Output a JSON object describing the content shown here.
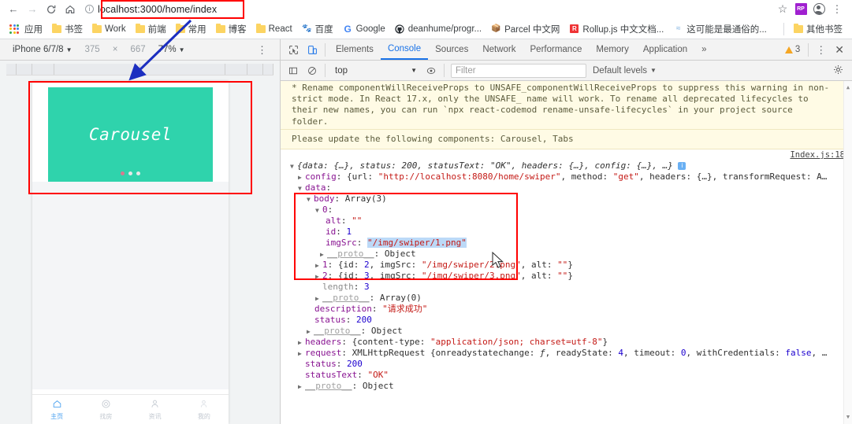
{
  "browser": {
    "nav": {
      "back": "←",
      "forward": "→",
      "reload": "C",
      "home": "⌂"
    },
    "omnibox": {
      "url": "localhost:3000/home/index",
      "info_icon": "i"
    },
    "right_icons": [
      {
        "name": "bookmark-star-icon",
        "glyph": "☆"
      },
      {
        "name": "extension-icon",
        "label": "RP"
      },
      {
        "name": "profile-avatar-icon",
        "glyph": ""
      },
      {
        "name": "chrome-menu-icon",
        "glyph": "⋮"
      }
    ],
    "bookmarks": [
      {
        "label": "应用",
        "icon": "apps-grid-icon"
      },
      {
        "label": "书签",
        "icon": "folder-icon"
      },
      {
        "label": "Work",
        "icon": "folder-icon"
      },
      {
        "label": "前端",
        "icon": "folder-icon"
      },
      {
        "label": "常用",
        "icon": "folder-icon"
      },
      {
        "label": "博客",
        "icon": "folder-icon"
      },
      {
        "label": "React",
        "icon": "folder-icon"
      },
      {
        "label": "百度",
        "icon": "baidu-icon"
      },
      {
        "label": "Google",
        "icon": "google-g-icon"
      },
      {
        "label": "deanhume/progr...",
        "icon": "github-icon"
      },
      {
        "label": "Parcel 中文网",
        "icon": "parcel-icon"
      },
      {
        "label": "Rollup.js 中文文档...",
        "icon": "rollup-icon"
      },
      {
        "label": "这可能是最通俗的...",
        "icon": "link-icon"
      }
    ],
    "other_bookmarks": {
      "label": "其他书签",
      "icon": "folder-icon"
    }
  },
  "device_toolbar": {
    "device": "iPhone 6/7/8",
    "device_caret": "▼",
    "width": "375",
    "times": "×",
    "height": "667",
    "zoom": "77%",
    "zoom_caret": "▼",
    "more": "⋮"
  },
  "mobile_page": {
    "carousel": {
      "label": "Carousel",
      "bg_color": "#2fd3ac",
      "dots": [
        {
          "active": true,
          "color": "#d9798f"
        },
        {
          "active": false,
          "color": "#e8e8e8"
        },
        {
          "active": false,
          "color": "#e8e8e8"
        }
      ]
    },
    "tabbar": [
      {
        "label": "主页",
        "icon": "home-icon",
        "glyph": "⌂",
        "active": true
      },
      {
        "label": "找房",
        "icon": "search-circle-icon",
        "glyph": "◎",
        "active": false
      },
      {
        "label": "资讯",
        "icon": "person-icon",
        "glyph": "⚇",
        "active": false
      },
      {
        "label": "我的",
        "icon": "person-icon",
        "glyph": "⚇",
        "active": false
      }
    ]
  },
  "devtools": {
    "inspect_icon": "inspect-element-icon",
    "device_toggle_icon": "toggle-device-toolbar-icon",
    "tabs": [
      {
        "label": "Elements",
        "selected": false
      },
      {
        "label": "Console",
        "selected": true
      },
      {
        "label": "Sources",
        "selected": false
      },
      {
        "label": "Network",
        "selected": false
      },
      {
        "label": "Performance",
        "selected": false
      },
      {
        "label": "Memory",
        "selected": false
      },
      {
        "label": "Application",
        "selected": false
      }
    ],
    "more_tabs": "»",
    "warning_count": "3",
    "panel_menu": "⋮",
    "close": "✕",
    "console_toolbar": {
      "sidebar_icon": "console-sidebar-icon",
      "clear_icon": "clear-console-icon",
      "context": "top",
      "context_caret": "▼",
      "eye_icon": "live-expression-icon",
      "filter_placeholder": "Filter",
      "levels": "Default levels",
      "levels_caret": "▼",
      "settings_icon": "gear-icon"
    },
    "messages": {
      "warning_line1": "* Rename componentWillReceiveProps to UNSAFE_componentWillReceiveProps to suppress this warning in non-",
      "warning_line2": "strict mode. In React 17.x, only the UNSAFE_ name will work. To rename all deprecated lifecycles to",
      "warning_line3": "their new names, you can run `npx react-codemod rename-unsafe-lifecycles` in your project source",
      "warning_line4": "folder.",
      "warning_line5": "Please update the following components: Carousel, Tabs",
      "source_link": "Index.js:18"
    },
    "log_object": {
      "summary_prefix": "{data: {…}, status: ",
      "summary_status": "200",
      "summary_mid": ", statusText: ",
      "summary_statustext": "\"OK\"",
      "summary_suffix": ", headers: {…}, config: {…}, …}",
      "config_key": "config",
      "config_value_pre": "{url: ",
      "config_url": "\"http://localhost:8080/home/swiper\"",
      "config_value_mid": ", method: ",
      "config_method": "\"get\"",
      "config_value_post": ", headers: {…}, transformRequest: A…",
      "data_key": "data",
      "body_key": "body",
      "body_value": "Array(3)",
      "item0_key": "0",
      "item0_alt_key": "alt",
      "item0_alt_value": "\"\"",
      "item0_id_key": "id",
      "item0_id_value": "1",
      "item0_imgsrc_key": "imgSrc",
      "item0_imgsrc_value": "\"/img/swiper/1.png\"",
      "proto_key": "__proto__",
      "proto_object": "Object",
      "item1_key": "1",
      "item1_value_a": "{id: ",
      "item1_id": "2",
      "item1_value_b": ", imgSrc: ",
      "item1_src": "\"/img/swiper/2.png\"",
      "item1_value_c": ", alt: ",
      "item1_alt": "\"\"",
      "item1_value_d": "}",
      "item2_key": "2",
      "item2_id": "3",
      "item2_src": "\"/img/swiper/3.png\"",
      "item2_alt": "\"\"",
      "length_key": "length",
      "length_value": "3",
      "proto_array": "Array(0)",
      "description_key": "description",
      "description_value": "\"请求成功\"",
      "status_key": "status",
      "status_value": "200",
      "headers_key": "headers",
      "headers_pre": "{content-type: ",
      "headers_value": "\"application/json; charset=utf-8\"",
      "headers_post": "}",
      "request_key": "request",
      "request_type": "XMLHttpRequest ",
      "request_pre": "{onreadystatechange: ",
      "request_f": "ƒ",
      "request_mid": ", readyState: ",
      "request_ready": "4",
      "request_mid2": ", timeout: ",
      "request_timeout": "0",
      "request_mid3": ", withCredentials: ",
      "request_cred": "false",
      "request_post": ", …",
      "root_status_key": "status",
      "root_status_value": "200",
      "root_statustext_key": "statusText",
      "root_statustext_value": "\"OK\"",
      "last_proto_key": "__proto__",
      "last_proto_value": "Object"
    }
  },
  "annotations": {
    "url_highlight_color": "#ff0000",
    "carousel_highlight_color": "#ff0000",
    "data_highlight_color": "#ff0000",
    "arrow_color": "#1c2fc0"
  }
}
